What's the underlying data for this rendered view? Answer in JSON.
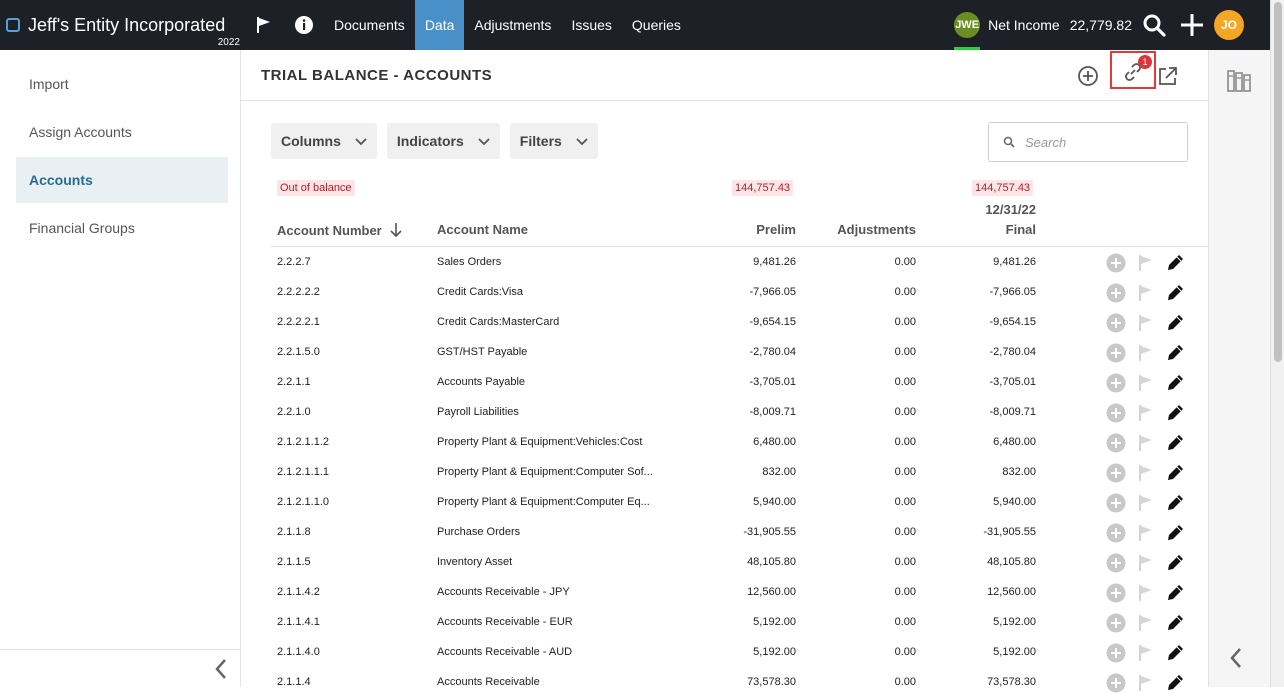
{
  "app": {
    "entity_name": "Jeff's Entity Incorporated",
    "year": "2022",
    "nav": [
      "Documents",
      "Data",
      "Adjustments",
      "Issues",
      "Queries"
    ],
    "entity_initials": "JWE",
    "net_income_label": "Net Income",
    "net_income_value": "22,779.82",
    "user_initials": "JO"
  },
  "sidebar": {
    "items": [
      "Import",
      "Assign Accounts",
      "Accounts",
      "Financial Groups"
    ],
    "active": "Accounts"
  },
  "page": {
    "title": "TRIAL BALANCE - ACCOUNTS",
    "link_badge": "1"
  },
  "filters": {
    "columns": "Columns",
    "indicators": "Indicators",
    "filters": "Filters",
    "search_placeholder": "Search"
  },
  "balance": {
    "out_of_balance": "Out of balance",
    "prelim_diff": "144,757.43",
    "final_diff": "144,757.43",
    "date": "12/31/22"
  },
  "table": {
    "headers": {
      "account_number": "Account Number",
      "account_name": "Account Name",
      "prelim": "Prelim",
      "adjustments": "Adjustments",
      "final": "Final"
    },
    "rows": [
      {
        "num": "2.2.2.7",
        "name": "Sales Orders",
        "prelim": "9,481.26",
        "adj": "0.00",
        "final": "9,481.26"
      },
      {
        "num": "2.2.2.2.2",
        "name": "Credit Cards:Visa",
        "prelim": "-7,966.05",
        "adj": "0.00",
        "final": "-7,966.05"
      },
      {
        "num": "2.2.2.2.1",
        "name": "Credit Cards:MasterCard",
        "prelim": "-9,654.15",
        "adj": "0.00",
        "final": "-9,654.15"
      },
      {
        "num": "2.2.1.5.0",
        "name": "GST/HST Payable",
        "prelim": "-2,780.04",
        "adj": "0.00",
        "final": "-2,780.04"
      },
      {
        "num": "2.2.1.1",
        "name": "Accounts Payable",
        "prelim": "-3,705.01",
        "adj": "0.00",
        "final": "-3,705.01"
      },
      {
        "num": "2.2.1.0",
        "name": "Payroll Liabilities",
        "prelim": "-8,009.71",
        "adj": "0.00",
        "final": "-8,009.71"
      },
      {
        "num": "2.1.2.1.1.2",
        "name": "Property Plant & Equipment:Vehicles:Cost",
        "prelim": "6,480.00",
        "adj": "0.00",
        "final": "6,480.00"
      },
      {
        "num": "2.1.2.1.1.1",
        "name": "Property Plant & Equipment:Computer Sof...",
        "prelim": "832.00",
        "adj": "0.00",
        "final": "832.00"
      },
      {
        "num": "2.1.2.1.1.0",
        "name": "Property Plant & Equipment:Computer Eq...",
        "prelim": "5,940.00",
        "adj": "0.00",
        "final": "5,940.00"
      },
      {
        "num": "2.1.1.8",
        "name": "Purchase Orders",
        "prelim": "-31,905.55",
        "adj": "0.00",
        "final": "-31,905.55"
      },
      {
        "num": "2.1.1.5",
        "name": "Inventory Asset",
        "prelim": "48,105.80",
        "adj": "0.00",
        "final": "48,105.80"
      },
      {
        "num": "2.1.1.4.2",
        "name": "Accounts Receivable - JPY",
        "prelim": "12,560.00",
        "adj": "0.00",
        "final": "12,560.00"
      },
      {
        "num": "2.1.1.4.1",
        "name": "Accounts Receivable - EUR",
        "prelim": "5,192.00",
        "adj": "0.00",
        "final": "5,192.00"
      },
      {
        "num": "2.1.1.4.0",
        "name": "Accounts Receivable - AUD",
        "prelim": "5,192.00",
        "adj": "0.00",
        "final": "5,192.00"
      },
      {
        "num": "2.1.1.4",
        "name": "Accounts Receivable",
        "prelim": "73,578.30",
        "adj": "0.00",
        "final": "73,578.30"
      }
    ]
  },
  "colors": {
    "topbar": "#1d2026",
    "nav_active": "#4a90c8",
    "alert_red": "#d9363e",
    "user_avatar": "#f5a623"
  }
}
